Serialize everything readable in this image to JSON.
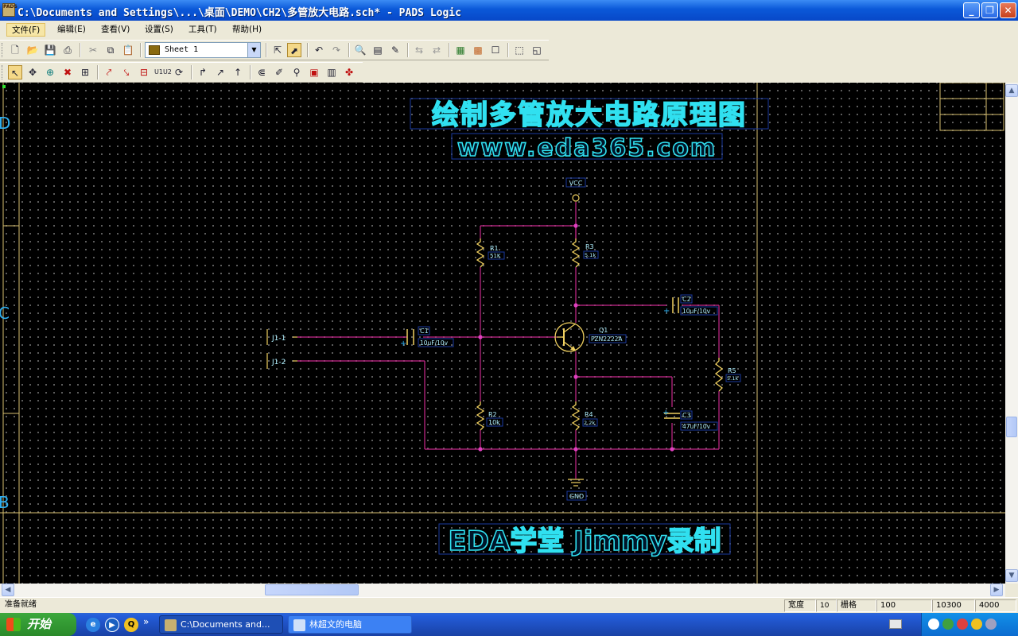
{
  "window": {
    "title": "C:\\Documents and Settings\\...\\桌面\\DEMO\\CH2\\多管放大电路.sch* - PADS Logic",
    "app_icon": "pads-app-icon",
    "controls": [
      "minimize",
      "restore",
      "close"
    ]
  },
  "menubar": {
    "items": [
      {
        "label": "文件(F)",
        "active": true
      },
      {
        "label": "编辑(E)",
        "active": false
      },
      {
        "label": "查看(V)",
        "active": false
      },
      {
        "label": "设置(S)",
        "active": false
      },
      {
        "label": "工具(T)",
        "active": false
      },
      {
        "label": "帮助(H)",
        "active": false
      }
    ]
  },
  "toolbar1": {
    "sheet_value": "Sheet 1",
    "icons": [
      "new-icon",
      "open-icon",
      "save-icon",
      "print-icon",
      "cut-icon",
      "copy-icon",
      "paste-icon",
      "select-filter-icon",
      "select-mode-icon",
      "undo-icon",
      "redo-icon",
      "zoom-icon",
      "sheet-list-icon",
      "redraw-icon",
      "pcb-link-icon",
      "router-link-icon",
      "pads-pcb-icon",
      "pads-router-icon",
      "properties-icon",
      "report-icon",
      "window-icon"
    ]
  },
  "toolbar2": {
    "icons": [
      "select-icon",
      "move-icon",
      "add-component-icon",
      "delete-icon",
      "properties-icon",
      "add-connection-icon",
      "add-bus-icon",
      "add-field-icon",
      "swap-icon",
      "rotate-icon",
      "add-pin-icon",
      "add-text-icon",
      "add-net-label-icon",
      "net-icon",
      "edit-part-icon",
      "part-editor-icon",
      "decal-editor-icon",
      "library-icon",
      "move-label-icon"
    ]
  },
  "schematic": {
    "title_text": "绘制多管放大电路原理图",
    "url_text": "www.eda365.com",
    "footer_text": "EDA学堂 Jimmy录制",
    "border_labels": [
      "D",
      "C",
      "B"
    ],
    "power_label": "VCC",
    "ground_label": "GND",
    "connectors": [
      {
        "ref": "J1-1"
      },
      {
        "ref": "J1-2"
      }
    ],
    "components": [
      {
        "ref": "R1",
        "value": "51K"
      },
      {
        "ref": "R3",
        "value": "5.1k"
      },
      {
        "ref": "R2",
        "value": "10k"
      },
      {
        "ref": "R4",
        "value": "2.2k"
      },
      {
        "ref": "R5",
        "value": "5.1k"
      },
      {
        "ref": "C1",
        "value": "10uF/10v"
      },
      {
        "ref": "C2",
        "value": "10uF/10v"
      },
      {
        "ref": "C3",
        "value": "47uF/10v"
      },
      {
        "ref": "Q1",
        "value": "PZN2222A"
      }
    ],
    "colors": {
      "background": "#000000",
      "wire": "#c8288c",
      "component": "#f0d060",
      "label": "#b0f0ff",
      "title_outline": "#30e0f0",
      "border": "#d8c070"
    }
  },
  "statusbar": {
    "message": "准备就绪",
    "width_label": "宽度",
    "width_value": "10",
    "grid_label": "栅格",
    "grid_value": "100",
    "coord_x": "10300",
    "coord_y": "4000"
  },
  "taskbar": {
    "start_label": "开始",
    "tasks": [
      {
        "label": "C:\\Documents and...",
        "active": true
      },
      {
        "label": "林超文的电脑",
        "active": false
      }
    ],
    "quicklaunch": [
      "ie-icon",
      "media-player-icon",
      "qq-icon"
    ],
    "tray_icons": [
      "network-icon",
      "volume-icon",
      "antivirus-icon",
      "qq-tray-icon",
      "security-icon"
    ],
    "overflow_glyph": "»"
  }
}
